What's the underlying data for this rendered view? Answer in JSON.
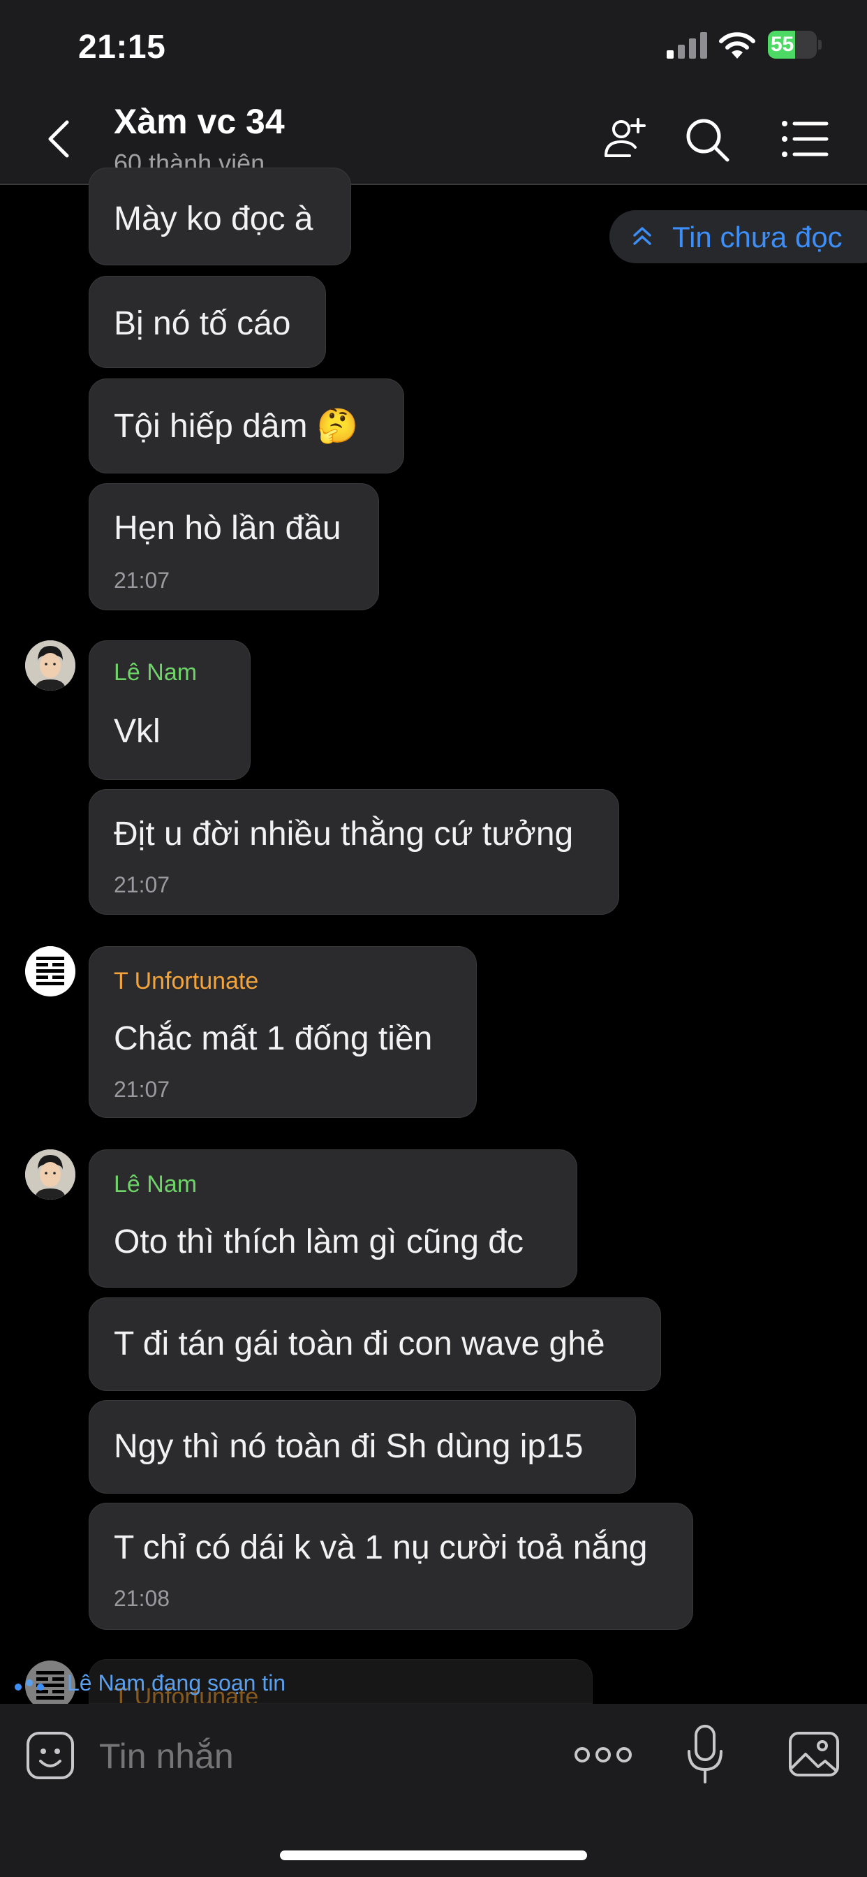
{
  "status_bar": {
    "time": "21:15",
    "battery": "55",
    "battery_level": 0.55
  },
  "header": {
    "title": "Xàm vc 34",
    "subtitle": "60 thành viên"
  },
  "unread_pill": {
    "label": "Tin chưa đọc"
  },
  "messages": [
    {
      "text": "Mày ko đọc à"
    },
    {
      "text": "Bị nó tố cáo"
    },
    {
      "text": "Tội hiếp dâm 🤔"
    },
    {
      "text": "Hẹn hò lần đầu",
      "time": "21:07"
    },
    {
      "sender": "Lê Nam",
      "text": "Vkl"
    },
    {
      "text": "Địt u đời nhiều thằng cứ tưởng",
      "time": "21:07"
    },
    {
      "sender": "T Unfortunate",
      "text": "Chắc mất 1 đống tiền",
      "time": "21:07"
    },
    {
      "sender": "Lê Nam",
      "text": "Oto thì thích làm gì cũng đc"
    },
    {
      "text": "T đi tán gái toàn đi con wave ghẻ"
    },
    {
      "text": "Ngy thì nó toàn đi Sh dùng ip15"
    },
    {
      "text": "T chỉ có dái k và 1 nụ cười toả nắng",
      "time": "21:08"
    },
    {
      "sender": "T Unfortunate"
    }
  ],
  "typing": {
    "text": "Lê Nam đang soạn tin"
  },
  "composer": {
    "placeholder": "Tin nhắn"
  },
  "colors": {
    "accent_blue": "#3d8ef7",
    "sender_le_nam": "#6fd36a",
    "sender_t_unfortunate": "#f4a43a",
    "bubble_bg": "#2b2b2d"
  }
}
